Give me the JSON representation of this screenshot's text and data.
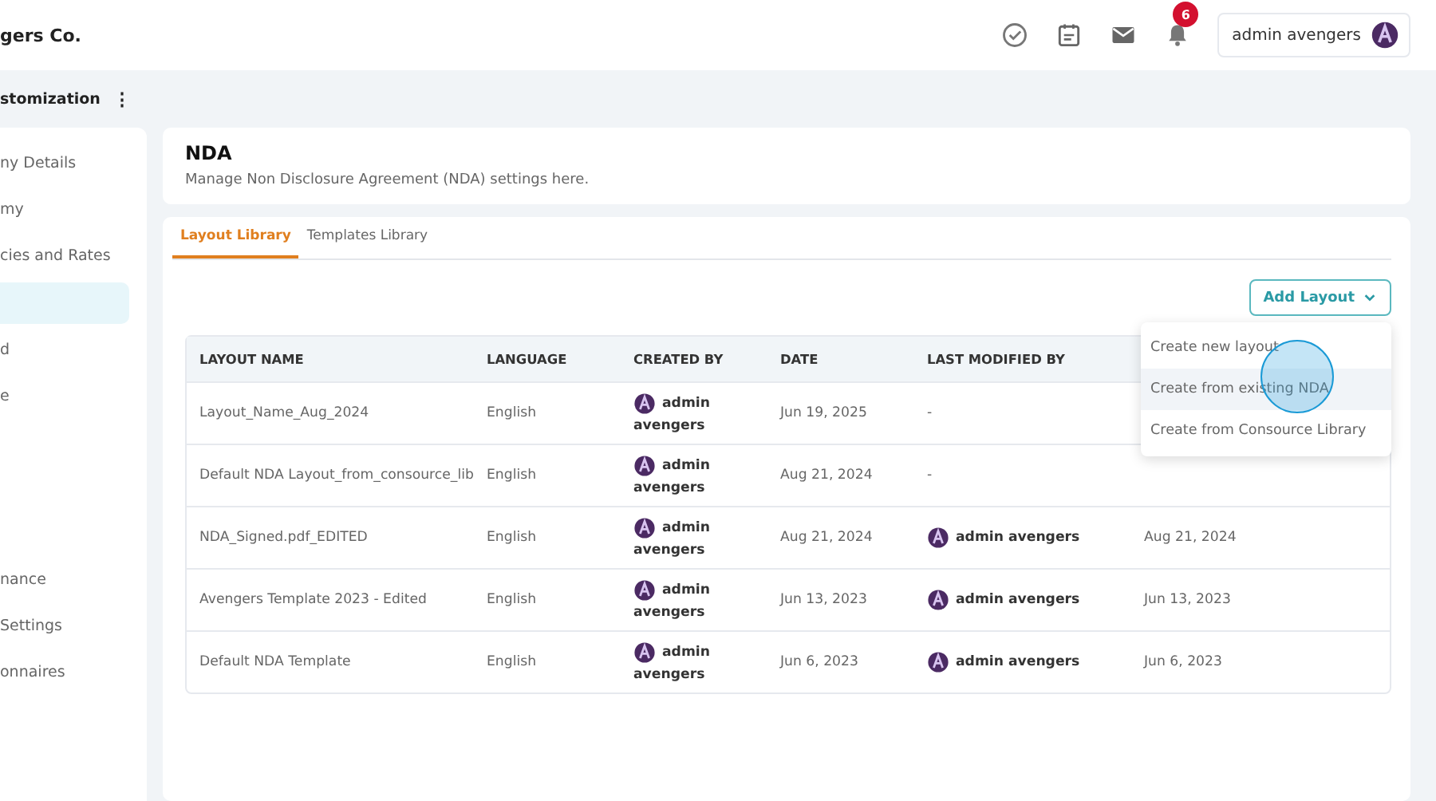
{
  "brand": "gers Co.",
  "header": {
    "notification_count": "6",
    "user": "admin avengers"
  },
  "section": {
    "title": "stomization",
    "menu_glyph": "⋮"
  },
  "sidebar": {
    "items": [
      {
        "label": "ny Details",
        "selected": false
      },
      {
        "label": "my",
        "selected": false
      },
      {
        "label": "cies and Rates",
        "selected": false
      },
      {
        "selected": true
      },
      {
        "label": "d",
        "selected": false
      },
      {
        "label": "e",
        "selected": false
      },
      {
        "label": "nance",
        "selected": false
      },
      {
        "label": " Settings",
        "selected": false
      },
      {
        "label": "onnaires",
        "selected": false
      }
    ]
  },
  "page": {
    "title": "NDA",
    "subtitle": "Manage Non Disclosure Agreement (NDA) settings here."
  },
  "tabs": [
    {
      "label": "Layout Library",
      "selected": true
    },
    {
      "label": "Templates Library",
      "selected": false
    }
  ],
  "add_button": "Add Layout",
  "menu": {
    "items": [
      {
        "label": "Create new layout",
        "hovered": false
      },
      {
        "label": "Create from existing NDA",
        "hovered": true
      },
      {
        "label": "Create from Consource Library",
        "hovered": false
      }
    ]
  },
  "table": {
    "columns": [
      "LAYOUT NAME",
      "LANGUAGE",
      "CREATED BY",
      "DATE",
      "LAST MODIFIED BY"
    ],
    "rows": [
      {
        "name": "Layout_Name_Aug_2024",
        "language": "English",
        "created_by": [
          "admin",
          "avengers"
        ],
        "date": "Jun 19, 2025",
        "modified_by": "-"
      },
      {
        "name": "Default NDA Layout_from_consource_lib",
        "language": "English",
        "created_by": [
          "admin",
          "avengers"
        ],
        "date": "Aug 21, 2024",
        "modified_by": "-"
      },
      {
        "name": "NDA_Signed.pdf_EDITED",
        "language": "English",
        "created_by": [
          "admin",
          "avengers"
        ],
        "date": "Aug 21, 2024",
        "modified_by": "admin avengers",
        "modified_date": "Aug 21, 2024"
      },
      {
        "name": "Avengers Template 2023 - Edited",
        "language": "English",
        "created_by": [
          "admin",
          "avengers"
        ],
        "date": "Jun 13, 2023",
        "modified_by": "admin avengers",
        "modified_date": "Jun 13, 2023"
      },
      {
        "name": "Default NDA Template",
        "language": "English",
        "created_by": [
          "admin",
          "avengers"
        ],
        "date": "Jun 6, 2023",
        "modified_by": "admin avengers",
        "modified_date": "Jun 6, 2023"
      }
    ]
  }
}
